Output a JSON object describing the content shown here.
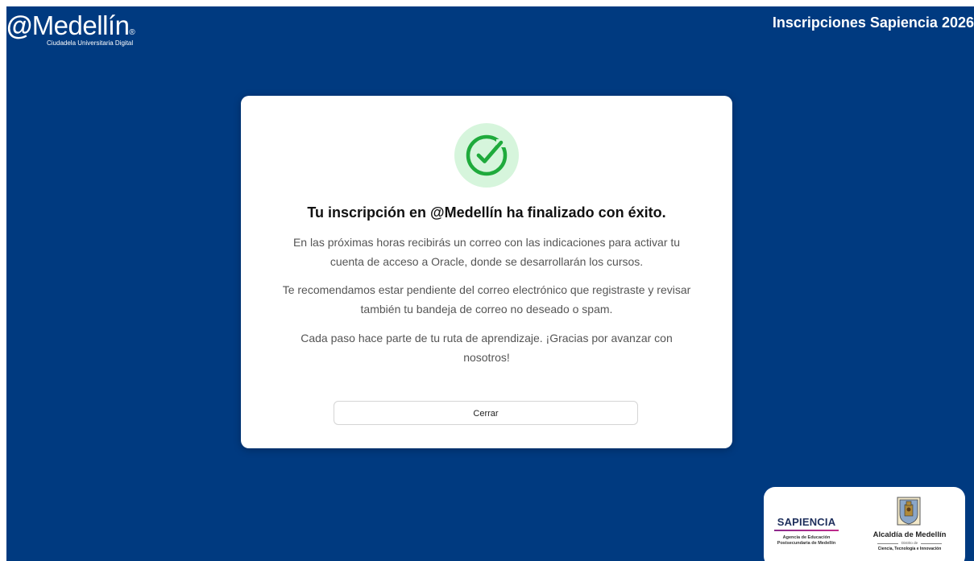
{
  "header": {
    "logo_at": "@",
    "logo_name": "Medellín",
    "logo_subtitle": "Ciudadela Universitaria Digital",
    "title": "Inscripciones Sapiencia 2026"
  },
  "modal": {
    "icon": "check-circle-icon",
    "title": "Tu inscripción en @Medellín ha finalizado con éxito.",
    "paragraphs": [
      "En las próximas horas recibirás un correo con las indicaciones para activar tu cuenta de acceso a Oracle, donde se desarrollarán los cursos.",
      "Te recomendamos estar pendiente del correo electrónico que registraste y revisar también tu bandeja de correo no deseado o spam.",
      "Cada paso hace parte de tu ruta de aprendizaje. ¡Gracias por avanzar con nosotros!"
    ],
    "close_label": "Cerrar"
  },
  "footer": {
    "sapiencia_name": "SAPIENCIA",
    "sapiencia_subtitle": "Agencia de Educación Postsecundaria de Medellín",
    "alcaldia_name": "Alcaldía de Medellín",
    "alcaldia_district": "Distrito de",
    "alcaldia_subtitle": "Ciencia, Tecnología e Innovación"
  },
  "colors": {
    "background": "#003a80",
    "success_circle": "#d6f5dc",
    "success_check": "#1faa3c"
  }
}
